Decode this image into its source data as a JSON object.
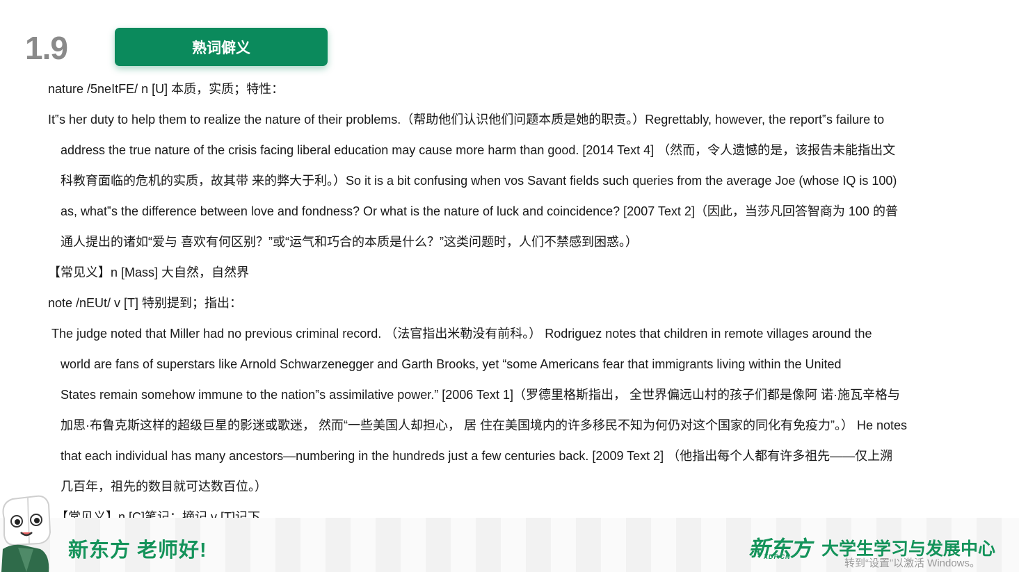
{
  "slide": {
    "number": "1.9",
    "title": "熟词僻义"
  },
  "lines": [
    "nature /5neItFE/ n [U] 本质，实质；特性：",
    "It‟s her duty to help them to realize the nature of their problems.（帮助他们认识他们问题本质是她的职责。）Regrettably, however, the report‟s failure to",
    "address the true nature of the crisis facing liberal education may cause more harm than good. [2014 Text 4] （然而，令人遗憾的是，该报告未能指出文",
    "科教育面临的危机的实质，故其带 来的弊大于利。）So it is a bit confusing when vos Savant fields such queries from the average Joe (whose IQ is 100)",
    "as, what‟s the difference between love and fondness? Or what is the nature of luck and coincidence? [2007 Text 2]（因此，当莎凡回答智商为 100 的普",
    "通人提出的诸如“爱与 喜欢有何区别？”或“运气和巧合的本质是什么？”这类问题时，人们不禁感到困惑。）",
    "【常见义】n [Mass] 大自然，自然界",
    "note /nEUt/ v [T] 特别提到；指出：",
    "The judge noted that Miller had no previous criminal record. （法官指出米勒没有前科。） Rodriguez notes that children in remote villages around the",
    "world are fans of superstars like Arnold Schwarzenegger and Garth Brooks, yet “some Americans fear that immigrants living within the United",
    "States remain somehow immune to the nation‟s assimilative power.” [2006 Text 1]（罗德里格斯指出， 全世界偏远山村的孩子们都是像阿 诺·施瓦辛格与",
    "加思·布鲁克斯这样的超级巨星的影迷或歌迷， 然而“一些美国人却担心， 居 住在美国境内的许多移民不知为何仍对这个国家的同化有免疫力”。） He notes",
    "that each individual has many ancestors—numbering in the hundreds just a few centuries back. [2009 Text 2] （他指出每个人都有许多祖先——仅上溯",
    "几百年，祖先的数目就可达数百位。）",
    "【常见义】n [C]笔记；摘记 v [T]记下"
  ],
  "footer": {
    "slogan": "新东方 老师好!",
    "logo": "新东方",
    "logo_sub": "XDF.CN",
    "center_name": "大学生学习与发展中心",
    "activate_notice": "转到“设置”以激活 Windows。"
  },
  "colors": {
    "brand_green": "#0b8a5c",
    "slogan_green": "#14935a",
    "slide_number_gray": "#8a8a8a"
  }
}
